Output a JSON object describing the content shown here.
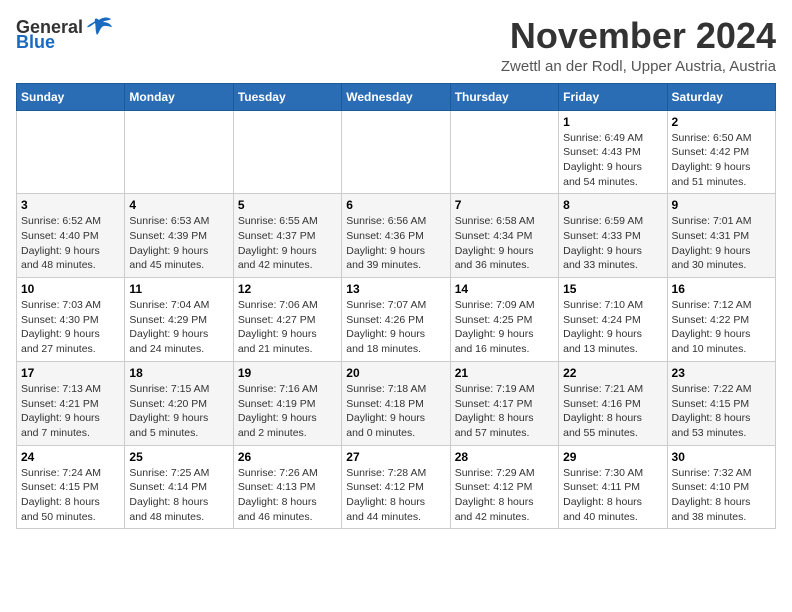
{
  "header": {
    "logo_general": "General",
    "logo_blue": "Blue",
    "title": "November 2024",
    "subtitle": "Zwettl an der Rodl, Upper Austria, Austria"
  },
  "weekdays": [
    "Sunday",
    "Monday",
    "Tuesday",
    "Wednesday",
    "Thursday",
    "Friday",
    "Saturday"
  ],
  "weeks": [
    [
      {
        "day": "",
        "info": ""
      },
      {
        "day": "",
        "info": ""
      },
      {
        "day": "",
        "info": ""
      },
      {
        "day": "",
        "info": ""
      },
      {
        "day": "",
        "info": ""
      },
      {
        "day": "1",
        "info": "Sunrise: 6:49 AM\nSunset: 4:43 PM\nDaylight: 9 hours\nand 54 minutes."
      },
      {
        "day": "2",
        "info": "Sunrise: 6:50 AM\nSunset: 4:42 PM\nDaylight: 9 hours\nand 51 minutes."
      }
    ],
    [
      {
        "day": "3",
        "info": "Sunrise: 6:52 AM\nSunset: 4:40 PM\nDaylight: 9 hours\nand 48 minutes."
      },
      {
        "day": "4",
        "info": "Sunrise: 6:53 AM\nSunset: 4:39 PM\nDaylight: 9 hours\nand 45 minutes."
      },
      {
        "day": "5",
        "info": "Sunrise: 6:55 AM\nSunset: 4:37 PM\nDaylight: 9 hours\nand 42 minutes."
      },
      {
        "day": "6",
        "info": "Sunrise: 6:56 AM\nSunset: 4:36 PM\nDaylight: 9 hours\nand 39 minutes."
      },
      {
        "day": "7",
        "info": "Sunrise: 6:58 AM\nSunset: 4:34 PM\nDaylight: 9 hours\nand 36 minutes."
      },
      {
        "day": "8",
        "info": "Sunrise: 6:59 AM\nSunset: 4:33 PM\nDaylight: 9 hours\nand 33 minutes."
      },
      {
        "day": "9",
        "info": "Sunrise: 7:01 AM\nSunset: 4:31 PM\nDaylight: 9 hours\nand 30 minutes."
      }
    ],
    [
      {
        "day": "10",
        "info": "Sunrise: 7:03 AM\nSunset: 4:30 PM\nDaylight: 9 hours\nand 27 minutes."
      },
      {
        "day": "11",
        "info": "Sunrise: 7:04 AM\nSunset: 4:29 PM\nDaylight: 9 hours\nand 24 minutes."
      },
      {
        "day": "12",
        "info": "Sunrise: 7:06 AM\nSunset: 4:27 PM\nDaylight: 9 hours\nand 21 minutes."
      },
      {
        "day": "13",
        "info": "Sunrise: 7:07 AM\nSunset: 4:26 PM\nDaylight: 9 hours\nand 18 minutes."
      },
      {
        "day": "14",
        "info": "Sunrise: 7:09 AM\nSunset: 4:25 PM\nDaylight: 9 hours\nand 16 minutes."
      },
      {
        "day": "15",
        "info": "Sunrise: 7:10 AM\nSunset: 4:24 PM\nDaylight: 9 hours\nand 13 minutes."
      },
      {
        "day": "16",
        "info": "Sunrise: 7:12 AM\nSunset: 4:22 PM\nDaylight: 9 hours\nand 10 minutes."
      }
    ],
    [
      {
        "day": "17",
        "info": "Sunrise: 7:13 AM\nSunset: 4:21 PM\nDaylight: 9 hours\nand 7 minutes."
      },
      {
        "day": "18",
        "info": "Sunrise: 7:15 AM\nSunset: 4:20 PM\nDaylight: 9 hours\nand 5 minutes."
      },
      {
        "day": "19",
        "info": "Sunrise: 7:16 AM\nSunset: 4:19 PM\nDaylight: 9 hours\nand 2 minutes."
      },
      {
        "day": "20",
        "info": "Sunrise: 7:18 AM\nSunset: 4:18 PM\nDaylight: 9 hours\nand 0 minutes."
      },
      {
        "day": "21",
        "info": "Sunrise: 7:19 AM\nSunset: 4:17 PM\nDaylight: 8 hours\nand 57 minutes."
      },
      {
        "day": "22",
        "info": "Sunrise: 7:21 AM\nSunset: 4:16 PM\nDaylight: 8 hours\nand 55 minutes."
      },
      {
        "day": "23",
        "info": "Sunrise: 7:22 AM\nSunset: 4:15 PM\nDaylight: 8 hours\nand 53 minutes."
      }
    ],
    [
      {
        "day": "24",
        "info": "Sunrise: 7:24 AM\nSunset: 4:15 PM\nDaylight: 8 hours\nand 50 minutes."
      },
      {
        "day": "25",
        "info": "Sunrise: 7:25 AM\nSunset: 4:14 PM\nDaylight: 8 hours\nand 48 minutes."
      },
      {
        "day": "26",
        "info": "Sunrise: 7:26 AM\nSunset: 4:13 PM\nDaylight: 8 hours\nand 46 minutes."
      },
      {
        "day": "27",
        "info": "Sunrise: 7:28 AM\nSunset: 4:12 PM\nDaylight: 8 hours\nand 44 minutes."
      },
      {
        "day": "28",
        "info": "Sunrise: 7:29 AM\nSunset: 4:12 PM\nDaylight: 8 hours\nand 42 minutes."
      },
      {
        "day": "29",
        "info": "Sunrise: 7:30 AM\nSunset: 4:11 PM\nDaylight: 8 hours\nand 40 minutes."
      },
      {
        "day": "30",
        "info": "Sunrise: 7:32 AM\nSunset: 4:10 PM\nDaylight: 8 hours\nand 38 minutes."
      }
    ]
  ]
}
